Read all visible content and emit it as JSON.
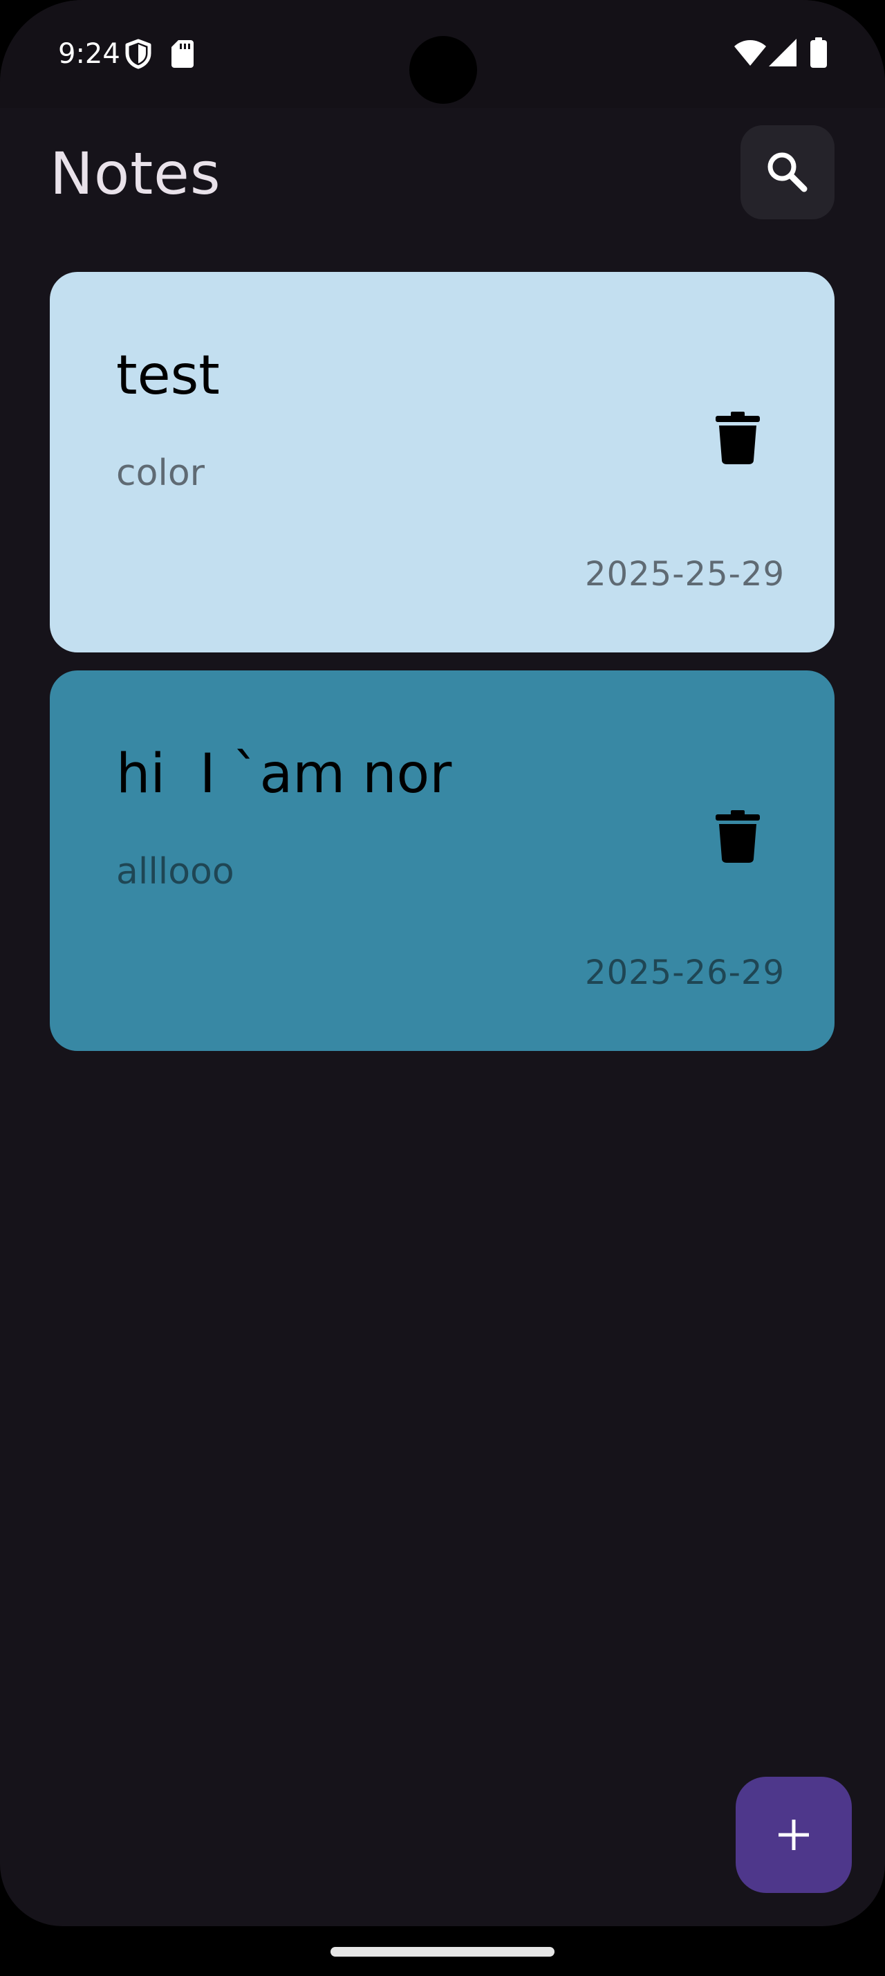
{
  "status_bar": {
    "time": "9:24",
    "icons": [
      "shield-icon",
      "sd-card-icon",
      "wifi-icon",
      "cellular-signal-icon",
      "battery-icon"
    ]
  },
  "header": {
    "title": "Notes",
    "search_icon": "search-icon"
  },
  "notes": [
    {
      "title": "test",
      "body": "color",
      "date": "2025-25-29",
      "background_color": "#c3dff0",
      "body_color": "#5f6a73",
      "date_color": "#5f6a73",
      "delete_icon": "trash-icon"
    },
    {
      "title": "hi  I `am nor",
      "body": "alllooo",
      "date": "2025-26-29",
      "background_color": "#3888a4",
      "body_color": "#1f4654",
      "date_color": "#1f4654",
      "delete_icon": "trash-icon"
    }
  ],
  "fab": {
    "icon": "plus-icon",
    "color": "#4e378b"
  },
  "colors": {
    "background": "#16131a",
    "title": "#e9e2ea",
    "search_button": "#25232a"
  }
}
